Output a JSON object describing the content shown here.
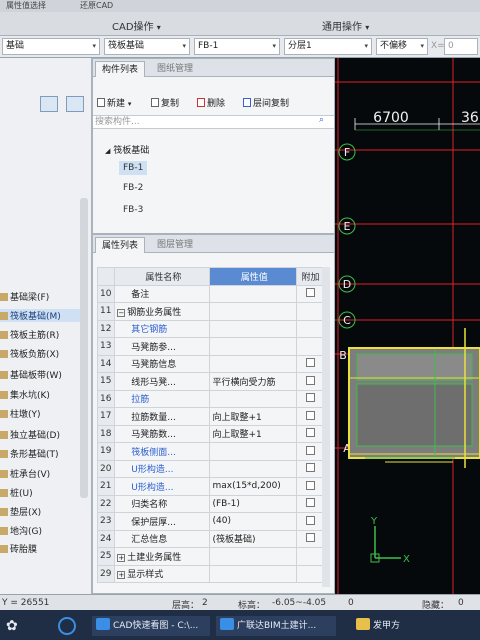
{
  "ribbon": {
    "top_left": "属性值选择",
    "top_mid": "还原CAD",
    "cad_ops": "CAD操作",
    "general_ops": "通用操作",
    "dropdown_arrow": "▾"
  },
  "selectors": {
    "floor": "基础",
    "type": "筏板基础",
    "item": "FB-1",
    "layer": "分层1",
    "offset": "不偏移",
    "x_label": "X=",
    "x_value": "0"
  },
  "leftnav": {
    "items": [
      {
        "label": "基础梁(F)"
      },
      {
        "label": "筏板基础(M)",
        "selected": true
      },
      {
        "label": "筏板主筋(R)"
      },
      {
        "label": "筏板负筋(X)"
      },
      {
        "label": "基础板带(W)"
      },
      {
        "label": "集水坑(K)"
      },
      {
        "label": "柱墩(Y)"
      },
      {
        "label": "独立基础(D)"
      },
      {
        "label": "条形基础(T)"
      },
      {
        "label": "桩承台(V)"
      },
      {
        "label": "桩(U)"
      },
      {
        "label": "垫层(X)"
      },
      {
        "label": "地沟(G)"
      },
      {
        "label": "砖胎膜"
      }
    ]
  },
  "component_panel": {
    "tabs": [
      "构件列表",
      "图纸管理"
    ],
    "toolbar": {
      "new": "新建",
      "copy": "复制",
      "delete": "删除",
      "floor_copy": "层间复制"
    },
    "search_placeholder": "搜索构件...",
    "tree_root": "筏板基础",
    "items": [
      "FB-1",
      "FB-2",
      "FB-3"
    ],
    "selected_item": "FB-1"
  },
  "props_panel": {
    "tabs": [
      "属性列表",
      "图层管理"
    ],
    "headers": {
      "name": "属性名称",
      "value": "属性值",
      "add": "附加"
    },
    "rows": [
      {
        "n": "10",
        "name": "备注",
        "value": "",
        "check": true,
        "color": "normal",
        "prefix": ""
      },
      {
        "n": "11",
        "name": "钢筋业务属性",
        "value": "",
        "check": false,
        "color": "normal",
        "prefix": "−"
      },
      {
        "n": "12",
        "name": "其它钢筋",
        "value": "",
        "check": false,
        "color": "blue",
        "prefix": ""
      },
      {
        "n": "13",
        "name": "马凳筋参...",
        "value": "",
        "check": false,
        "color": "normal",
        "prefix": ""
      },
      {
        "n": "14",
        "name": "马凳筋信息",
        "value": "",
        "check": true,
        "color": "normal",
        "prefix": ""
      },
      {
        "n": "15",
        "name": "线形马凳...",
        "value": "平行横向受力筋",
        "check": true,
        "color": "normal",
        "prefix": ""
      },
      {
        "n": "16",
        "name": "拉筋",
        "value": "",
        "check": true,
        "color": "blue",
        "prefix": ""
      },
      {
        "n": "17",
        "name": "拉筋数量...",
        "value": "向上取整+1",
        "check": true,
        "color": "normal",
        "prefix": ""
      },
      {
        "n": "18",
        "name": "马凳筋数...",
        "value": "向上取整+1",
        "check": true,
        "color": "normal",
        "prefix": ""
      },
      {
        "n": "19",
        "name": "筏板侧面...",
        "value": "",
        "check": true,
        "color": "blue",
        "prefix": ""
      },
      {
        "n": "20",
        "name": "U形构造...",
        "value": "",
        "check": true,
        "color": "blue",
        "prefix": ""
      },
      {
        "n": "21",
        "name": "U形构造...",
        "value": "max(15*d,200)",
        "check": true,
        "color": "blue",
        "prefix": ""
      },
      {
        "n": "22",
        "name": "归类名称",
        "value": "(FB-1)",
        "check": true,
        "color": "normal",
        "prefix": ""
      },
      {
        "n": "23",
        "name": "保护层厚...",
        "value": "(40)",
        "check": true,
        "color": "normal",
        "prefix": ""
      },
      {
        "n": "24",
        "name": "汇总信息",
        "value": "(筏板基础)",
        "check": true,
        "color": "normal",
        "prefix": ""
      },
      {
        "n": "25",
        "name": "土建业务属性",
        "value": "",
        "check": false,
        "color": "normal",
        "prefix": "+"
      },
      {
        "n": "29",
        "name": "显示样式",
        "value": "",
        "check": false,
        "color": "normal",
        "prefix": "+"
      }
    ]
  },
  "cad": {
    "dim1": "6700",
    "dim2": "36",
    "axes": [
      "F",
      "E",
      "D",
      "C",
      "B",
      "A"
    ],
    "ucs_x": "X",
    "ucs_y": "Y"
  },
  "status": {
    "coord": "Y = 26551",
    "floor_label": "层高：",
    "floor_value": "2",
    "elev_label": "标高：",
    "elev_value": "-6.05~-4.05",
    "zero": "0",
    "hidden_label": "隐藏：",
    "hidden_value": "0"
  },
  "taskbar": {
    "app1": "CAD快速看图 - C:\\...",
    "app2": "广联达BIM土建计...",
    "app3": "发甲方"
  },
  "colors": {
    "grid_red": "#e0202a",
    "rebar_yellow": "#e8e23a",
    "axis_green": "#3fbf4a",
    "dim_white": "#f0f0f0",
    "accent_blue": "#5a8ad2"
  }
}
